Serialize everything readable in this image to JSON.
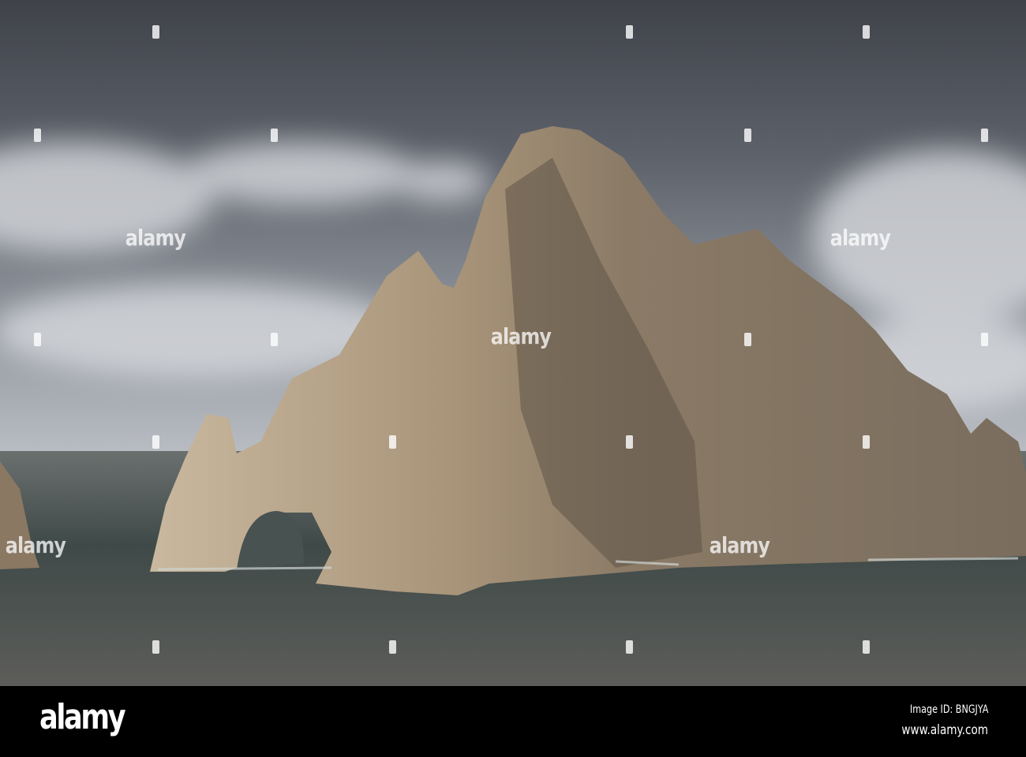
{
  "photo": {
    "subject": "sea-arch-rock-formation",
    "colors": {
      "sky_dark": "#4a4d55",
      "sky_light": "#c9ccd2",
      "sea": "#4a5250",
      "rock_lit": "#c8b69a",
      "rock_shadow": "#6a5d4f"
    },
    "watermark_text": "alamy"
  },
  "footer": {
    "logo": "alamy",
    "image_id": "Image ID: BNGJYA",
    "url": "www.alamy.com"
  }
}
